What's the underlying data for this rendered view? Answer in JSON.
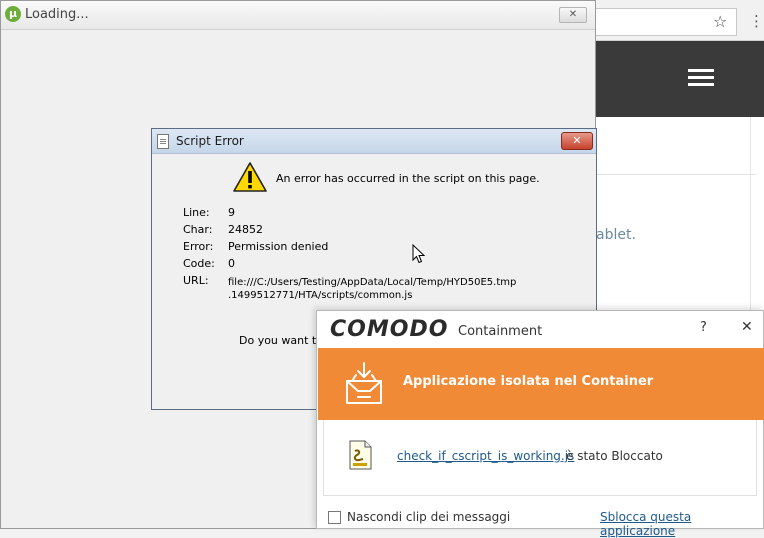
{
  "browser": {
    "star_glyph": "☆",
    "menu_glyph": "⋮",
    "text_fragment": "ablet."
  },
  "loading_window": {
    "title": "Loading...",
    "close_glyph": "✕"
  },
  "script_error": {
    "title": "Script Error",
    "close_glyph": "✕",
    "message": "An error has occurred in the script on this page.",
    "labels": {
      "line": "Line:",
      "char": "Char:",
      "error": "Error:",
      "code": "Code:",
      "url": "URL:"
    },
    "values": {
      "line": "9",
      "char": "24852",
      "error": "Permission denied",
      "code": "0",
      "url_line1": "file:///C:/Users/Testing/AppData/Local/Temp/HYD50E5.tmp",
      "url_line2": ".1499512771/HTA/scripts/common.js"
    },
    "prompt_visible": "Do you want to c"
  },
  "comodo": {
    "brand": "COMODO",
    "product": "Containment",
    "help_glyph": "?",
    "close_glyph": "✕",
    "banner_text": "Applicazione isolata nel Container",
    "file_name": "check_if_cscript_is_working.js",
    "file_status": "è stato Bloccato",
    "hide_messages_label": "Nascondi clip dei messaggi",
    "unblock_link": "Sblocca questa applicazione",
    "accent_color": "#f08a36"
  }
}
